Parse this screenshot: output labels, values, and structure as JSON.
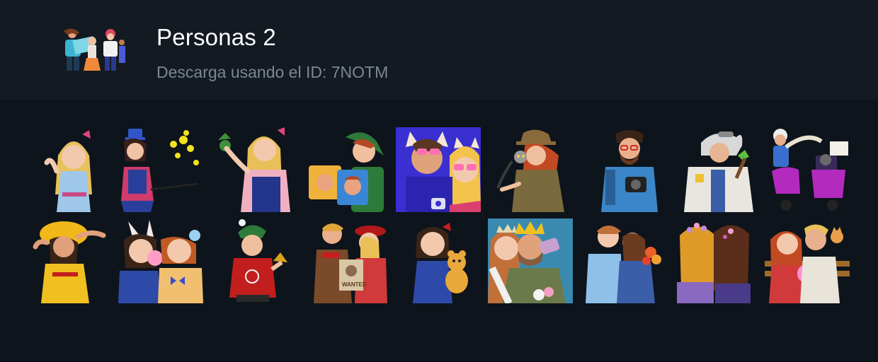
{
  "pack": {
    "title": "Personas 2",
    "subtitle": "Descarga usando el ID: 7NOTM",
    "thumbnail_icon": "sticker-pack-preview-icon"
  },
  "colors": {
    "page_bg": "#0e141b",
    "header_bg": "#131a21",
    "title": "#ffffff",
    "subtitle": "#7b8792"
  },
  "stickers": [
    {
      "icon": "blonde-girl-bow-sticker"
    },
    {
      "icon": "magician-woman-flowers-sticker"
    },
    {
      "icon": "farmer-girl-apple-sticker"
    },
    {
      "icon": "elf-boy-photos-sticker"
    },
    {
      "icon": "couple-fox-ears-selfie-sticker"
    },
    {
      "icon": "explorer-woman-lemur-sticker"
    },
    {
      "icon": "bearded-man-camera-sticker"
    },
    {
      "icon": "scientist-old-man-sticker"
    },
    {
      "icon": "scooter-rider-cat-sticker"
    },
    {
      "icon": "girl-yellow-hat-sticker"
    },
    {
      "icon": "kids-bubblegum-bunny-ears-sticker"
    },
    {
      "icon": "elf-bell-sweater-sticker"
    },
    {
      "icon": "cowboy-couple-wanted-sticker"
    },
    {
      "icon": "girl-teddy-bear-sticker"
    },
    {
      "icon": "king-queen-selfie-sticker"
    },
    {
      "icon": "couple-kiss-bouquet-sticker"
    },
    {
      "icon": "girls-back-view-sticker"
    },
    {
      "icon": "couple-bench-cat-sticker"
    }
  ]
}
